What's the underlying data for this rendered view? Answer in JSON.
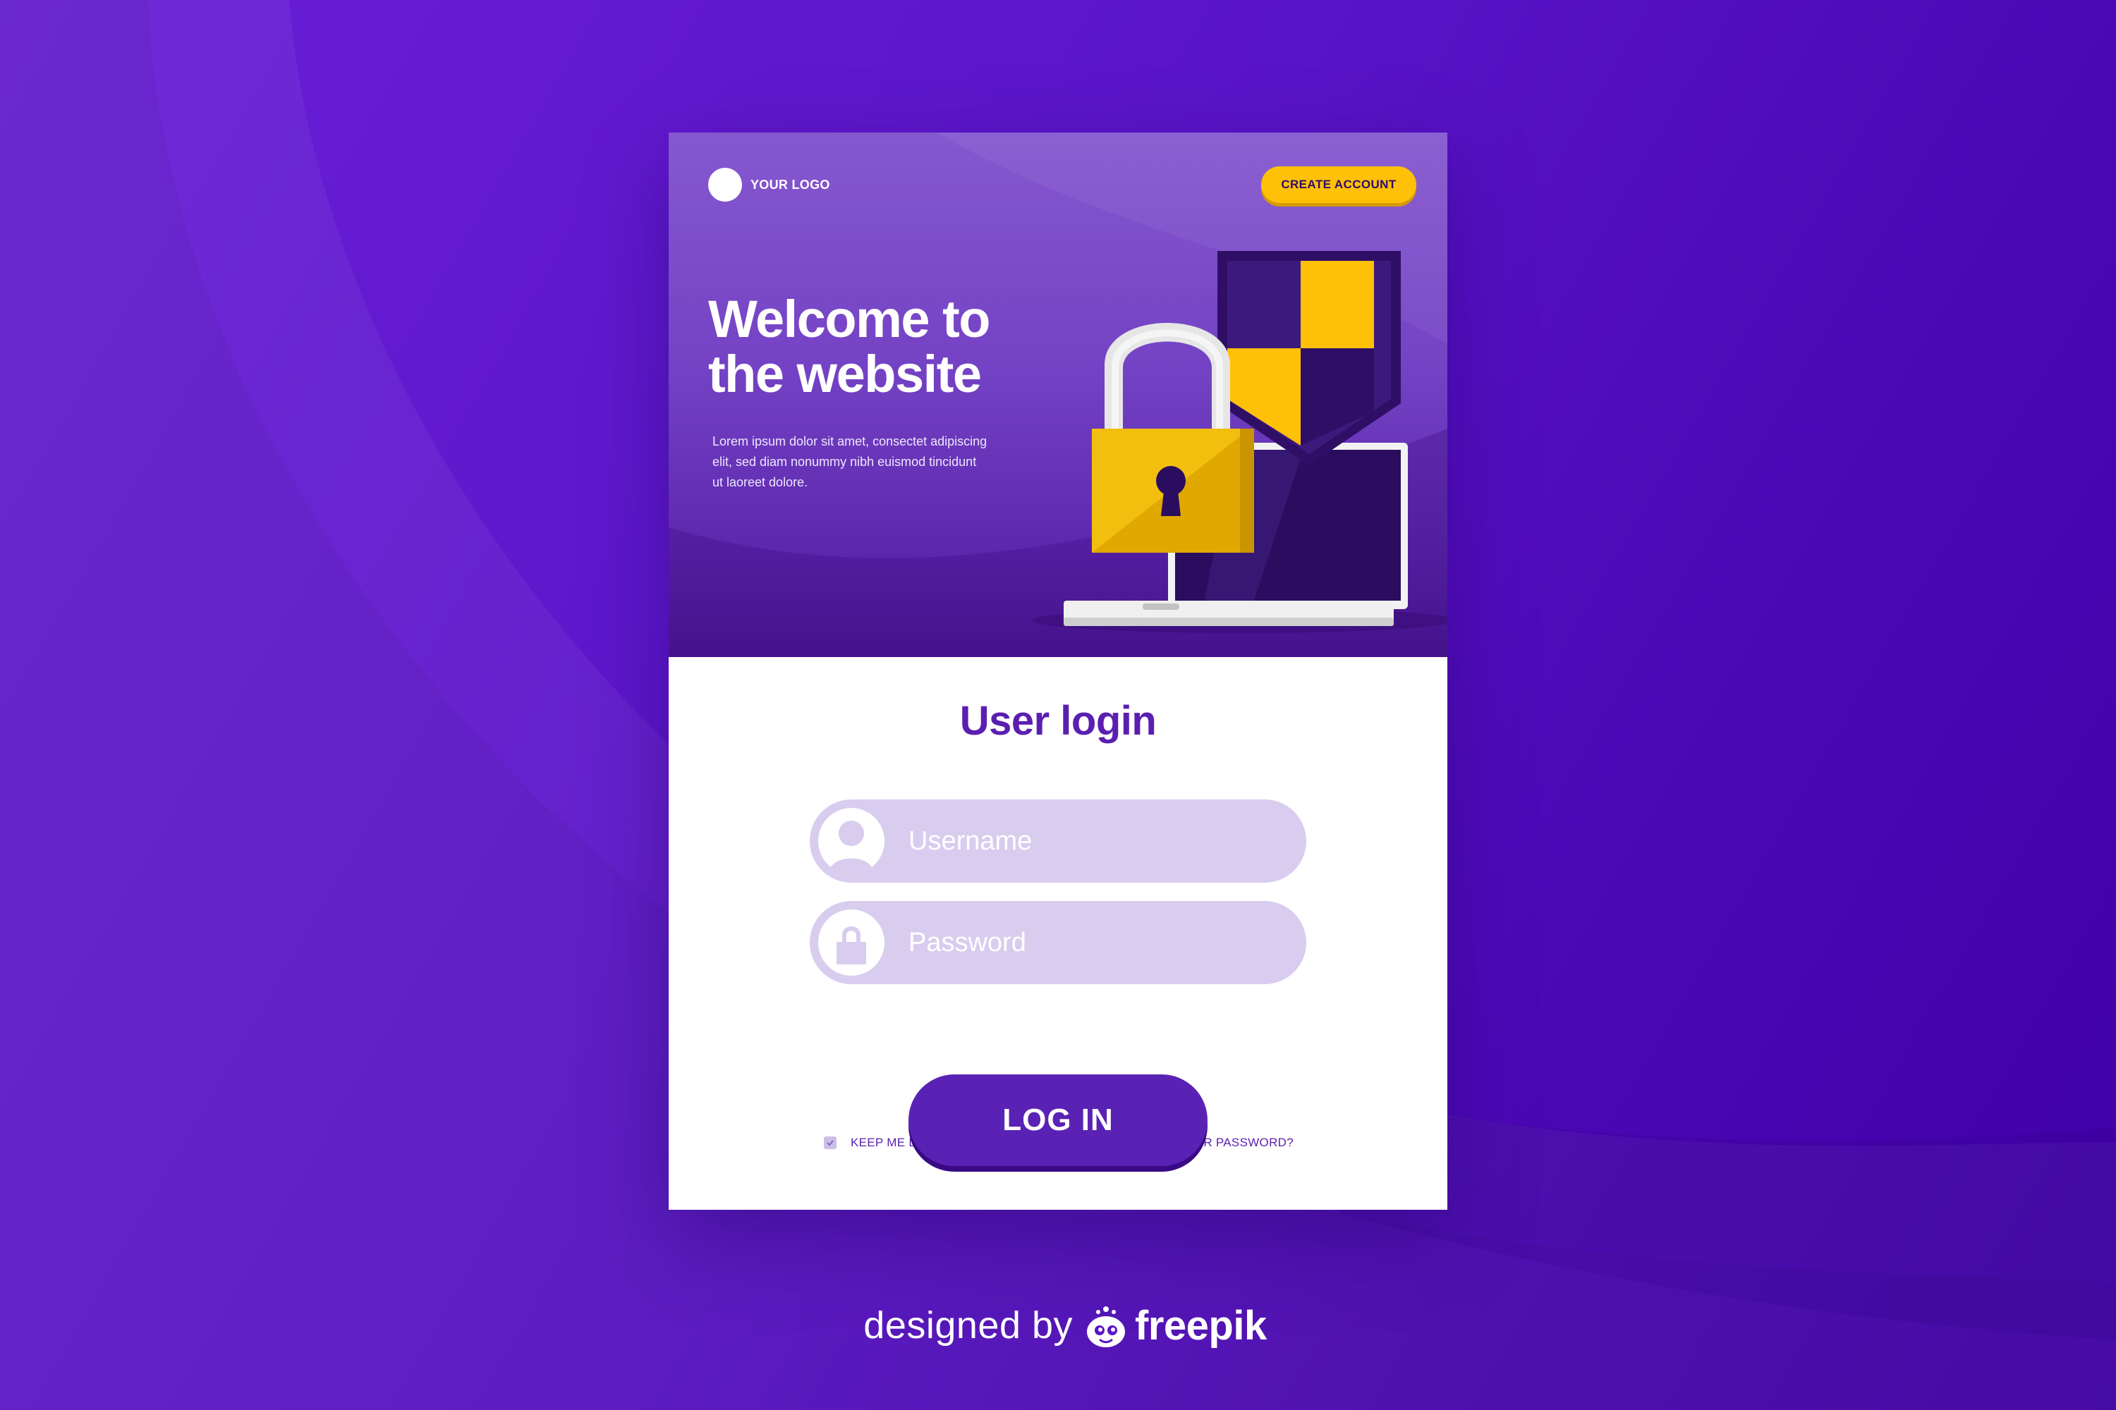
{
  "header": {
    "logo_text": "YOUR LOGO",
    "create_account_label": "CREATE ACCOUNT"
  },
  "hero": {
    "title_line1": "Welcome to",
    "title_line2": "the website",
    "subtitle": "Lorem ipsum dolor sit amet, consectet adipiscing elit, sed diam nonummy nibh euismod tincidunt ut laoreet dolore."
  },
  "form": {
    "title": "User login",
    "username": {
      "value": "",
      "placeholder": "Username",
      "icon": "user-icon"
    },
    "password": {
      "value": "",
      "placeholder": "Password",
      "icon": "lock-icon"
    },
    "keep_logged_in": {
      "label": "KEEP ME LOGGED IN",
      "checked": true
    },
    "forgot_label": "FORGOT YOUR PASSWORD?",
    "login_label": "LOG IN"
  },
  "credit": {
    "prefix": "designed by",
    "brand": "freepik"
  },
  "colors": {
    "background": "#5a14c8",
    "accent_yellow": "#ffc107",
    "primary_purple": "#5a22b4",
    "field_fill": "#d8cdee",
    "title_purple": "#5a1fb0"
  }
}
